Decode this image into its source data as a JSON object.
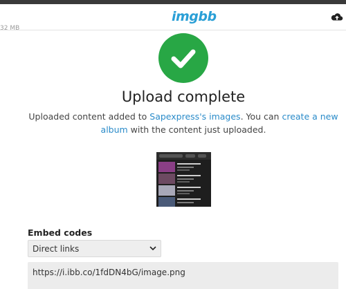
{
  "header": {
    "logo": "imgbb",
    "side_text": "32 MB"
  },
  "main": {
    "title": "Upload complete",
    "desc_prefix": "Uploaded content added to ",
    "images_link": "Sapexpress's images",
    "desc_middle": ". You can ",
    "album_link": "create a new album",
    "desc_suffix": " with the content just uploaded."
  },
  "embed": {
    "label": "Embed codes",
    "selected": "Direct links",
    "code": "https://i.ibb.co/1fdDN4bG/image.png"
  },
  "colors": {
    "brand": "#2a9fd6",
    "success": "#28a745",
    "link": "#2a8bc9"
  },
  "icons": {
    "success": "check-icon",
    "upload": "cloud-upload-icon",
    "dropdown": "chevron-down-icon"
  }
}
